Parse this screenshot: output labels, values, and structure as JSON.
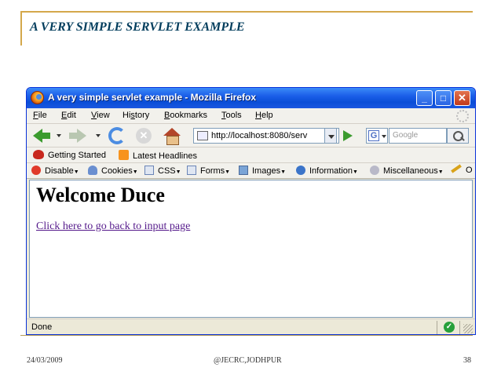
{
  "slide": {
    "title": "A VERY SIMPLE SERVLET EXAMPLE",
    "footer_date": "24/03/2009",
    "footer_center": "@JECRC,JODHPUR",
    "page_number": "38"
  },
  "browser": {
    "window_title": "A very simple servlet example - Mozilla Firefox",
    "window_buttons": {
      "minimize": "_",
      "maximize": "□",
      "close": "✕"
    },
    "menu": {
      "file": {
        "mnemonic": "F",
        "rest": "ile"
      },
      "edit": {
        "mnemonic": "E",
        "rest": "dit"
      },
      "view": {
        "mnemonic": "V",
        "rest": "iew"
      },
      "history": {
        "pre": "Hi",
        "mnemonic": "s",
        "rest": "tory"
      },
      "bookmarks": {
        "mnemonic": "B",
        "rest": "ookmarks"
      },
      "tools": {
        "mnemonic": "T",
        "rest": "ools"
      },
      "help": {
        "mnemonic": "H",
        "rest": "elp"
      }
    },
    "url": "http://localhost:8080/serv",
    "search_engine_icon": "G",
    "search_placeholder": "Google",
    "bookmarks": [
      "Getting Started",
      "Latest Headlines"
    ],
    "dev_toolbar": [
      "Disable",
      "Cookies",
      "CSS",
      "Forms",
      "Images",
      "Information",
      "Miscellaneous",
      "O"
    ],
    "icons": [
      "firefox-logo-icon",
      "back-arrow-icon",
      "forward-arrow-icon",
      "reload-icon",
      "stop-icon",
      "home-icon",
      "go-arrow-icon",
      "search-magnifier-icon",
      "throbber-icon",
      "rss-icon",
      "status-ok-icon"
    ],
    "status": "Done"
  },
  "page": {
    "heading": "Welcome Duce",
    "link_text": "Click here to go back to input page"
  }
}
